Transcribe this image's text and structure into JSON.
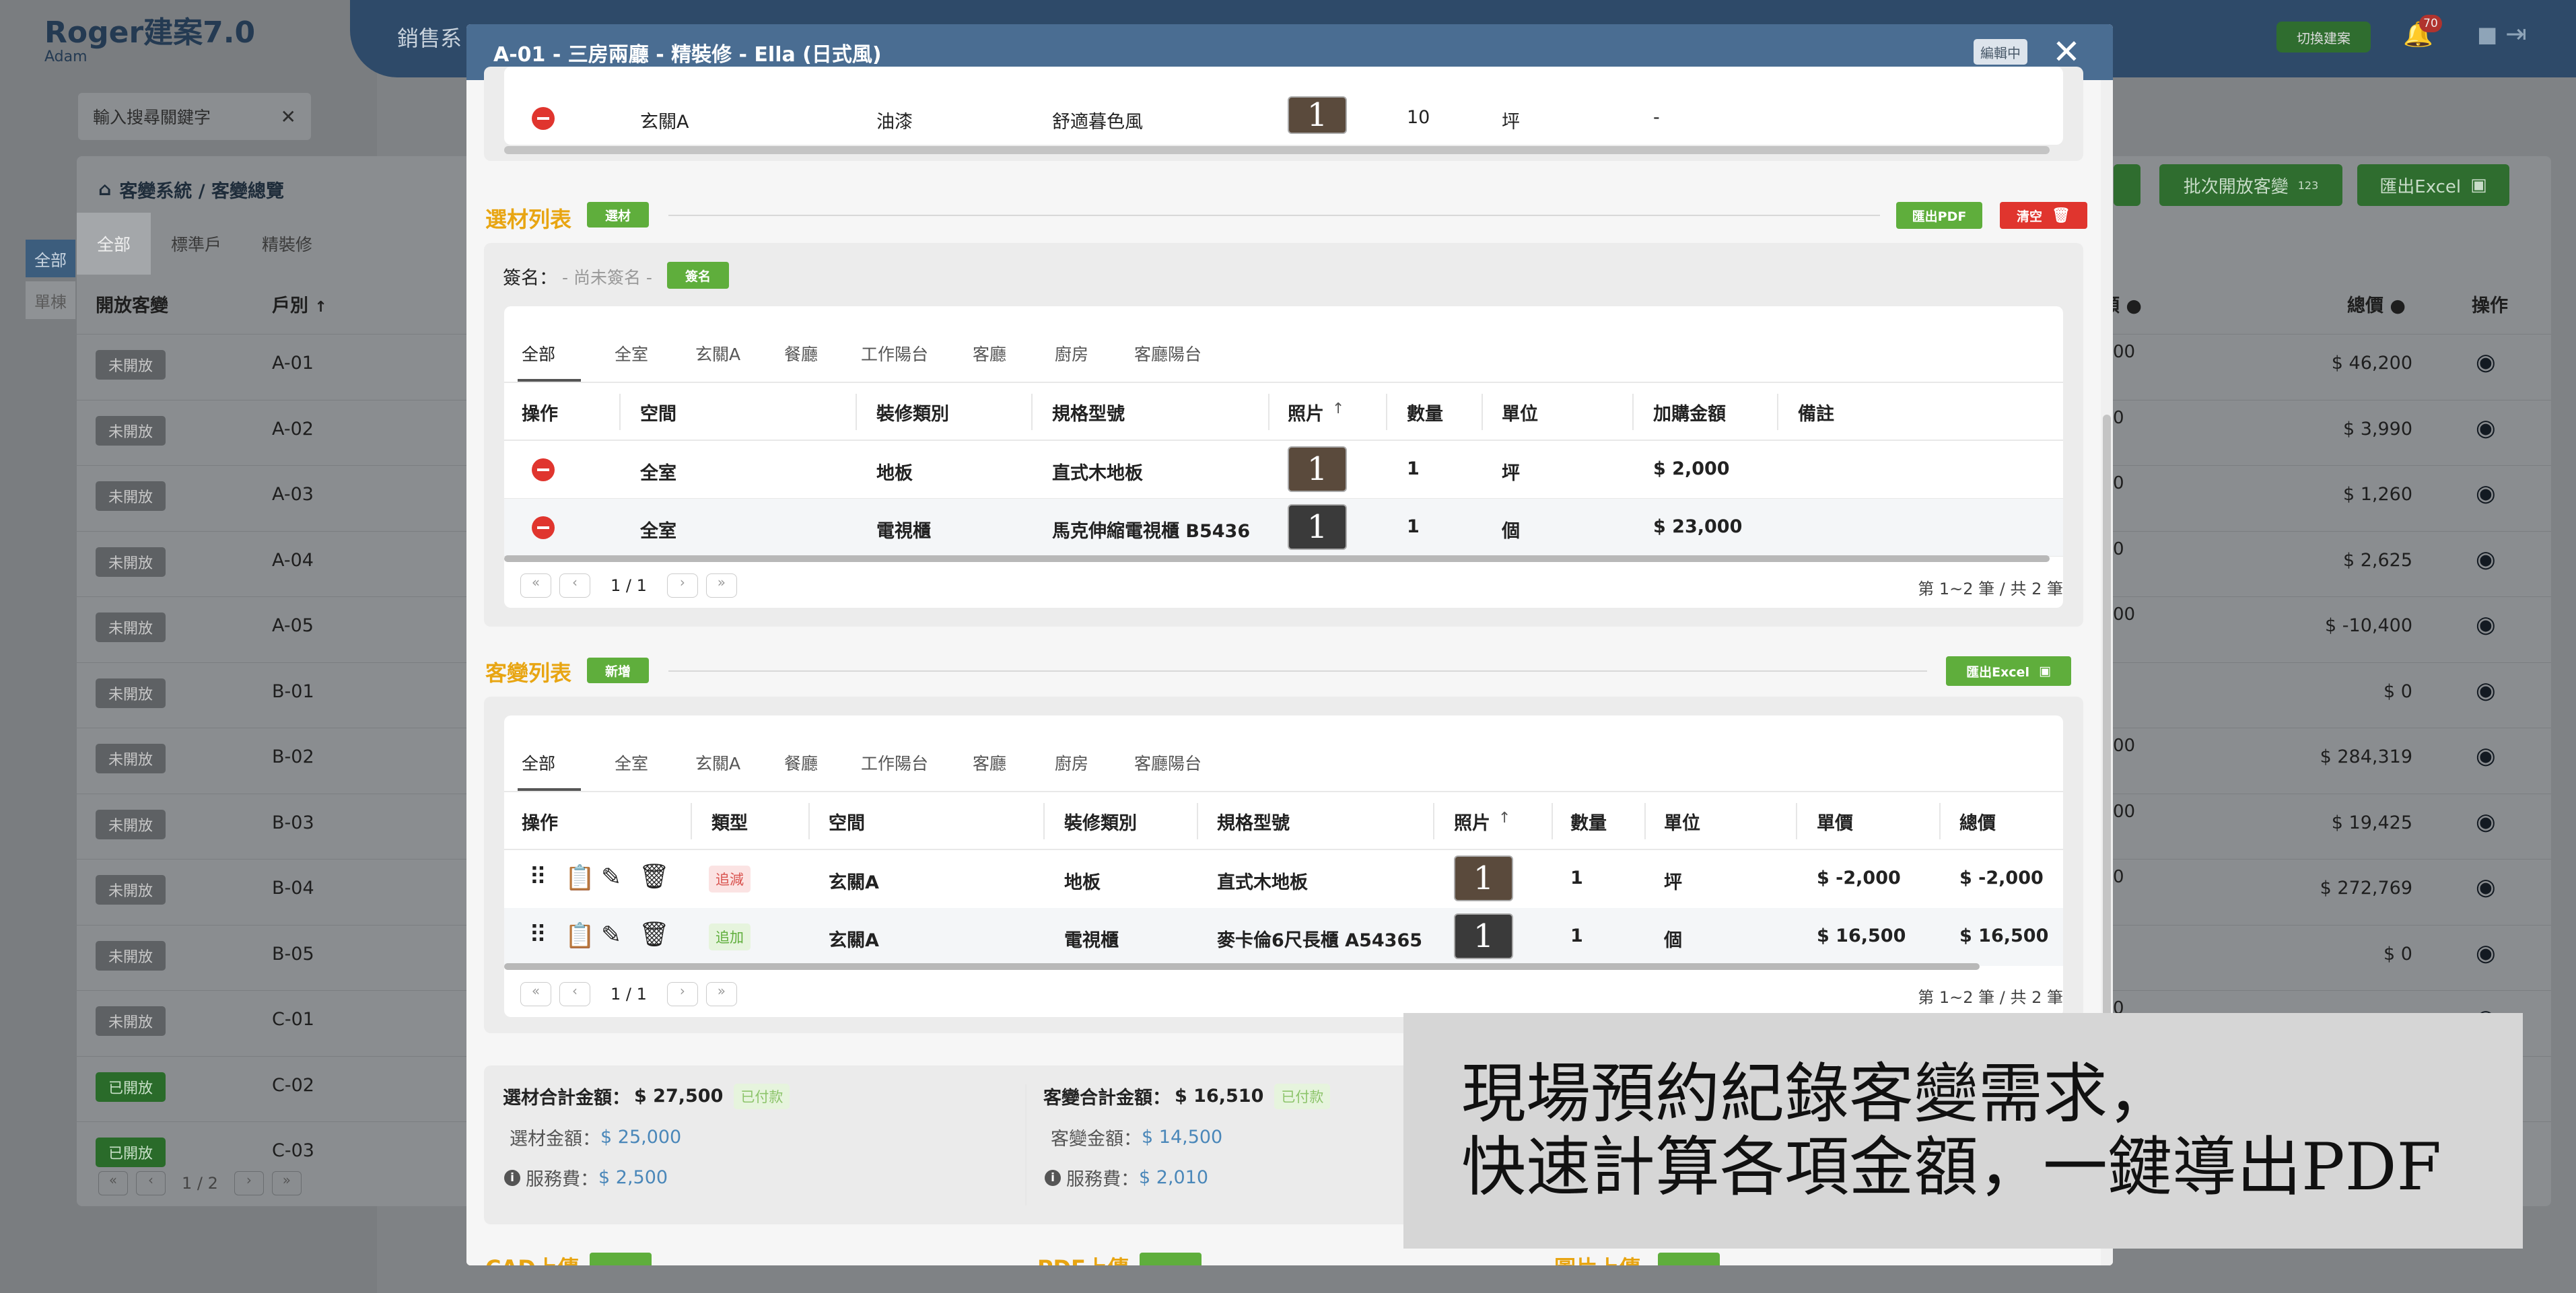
{
  "app": {
    "brand": "Roger建案7.0",
    "user": "Adam",
    "nav_label": "銷售系",
    "switch_label": "切換建案",
    "notification_count": "70",
    "search_placeholder": "輸入搜尋關鍵字",
    "breadcrumb": "客變系統 / 客變總覽",
    "tabs": [
      "全部",
      "標準戶",
      "精裝修"
    ],
    "side_tabs": [
      "全部",
      "單棟"
    ],
    "columns": {
      "open": "開放客變",
      "unit": "戶別"
    },
    "right_columns": {
      "amount_suffix": "額",
      "total": "總價",
      "ops": "操作"
    },
    "buttons": {
      "batch_open": "批次開放客變",
      "batch_badge": "123",
      "export_excel": "匯出Excel"
    },
    "rows": [
      {
        "status": "未開放",
        "unit": "A-01",
        "amount_frag": "00",
        "total": "$ 46,200",
        "open": false
      },
      {
        "status": "未開放",
        "unit": "A-02",
        "amount_frag": "0",
        "total": "$ 3,990",
        "open": false
      },
      {
        "status": "未開放",
        "unit": "A-03",
        "amount_frag": "0",
        "total": "$ 1,260",
        "open": false
      },
      {
        "status": "未開放",
        "unit": "A-04",
        "amount_frag": "0",
        "total": "$ 2,625",
        "open": false
      },
      {
        "status": "未開放",
        "unit": "A-05",
        "amount_frag": "00",
        "total": "$ -10,400",
        "open": false
      },
      {
        "status": "未開放",
        "unit": "B-01",
        "amount_frag": "",
        "total": "$ 0",
        "open": false
      },
      {
        "status": "未開放",
        "unit": "B-02",
        "amount_frag": "00",
        "total": "$ 284,319",
        "open": false
      },
      {
        "status": "未開放",
        "unit": "B-03",
        "amount_frag": "00",
        "total": "$ 19,425",
        "open": false
      },
      {
        "status": "未開放",
        "unit": "B-04",
        "amount_frag": "0",
        "total": "$ 272,769",
        "open": false
      },
      {
        "status": "未開放",
        "unit": "B-05",
        "amount_frag": "",
        "total": "$ 0",
        "open": false
      },
      {
        "status": "未開放",
        "unit": "C-01",
        "amount_frag": "0",
        "total": "",
        "open": false
      },
      {
        "status": "已開放",
        "unit": "C-02",
        "amount_frag": "",
        "total": "",
        "open": true
      },
      {
        "status": "已開放",
        "unit": "C-03",
        "amount_frag": "",
        "total": "",
        "open": true
      }
    ],
    "pager": {
      "page": "1 / 2"
    }
  },
  "modal": {
    "title": "A-01 - 三房兩廳 - 精裝修 - Ella (日式風)",
    "editing_badge": "編輯中",
    "top_row": {
      "space": "玄關A",
      "category": "油漆",
      "spec": "舒適暮色風",
      "qty": "10",
      "unit": "坪",
      "price": "-"
    },
    "selection": {
      "title": "選材列表",
      "tag": "選材",
      "export_pdf": "匯出PDF",
      "clear": "清空",
      "sign_label": "簽名：",
      "sign_placeholder": "- 尚未簽名 -",
      "sign_button": "簽名",
      "tabs": [
        "全部",
        "全室",
        "玄關A",
        "餐廳",
        "工作陽台",
        "客廳",
        "廚房",
        "客廳陽台"
      ],
      "columns": [
        "操作",
        "空間",
        "裝修類別",
        "規格型號",
        "照片",
        "數量",
        "單位",
        "加購金額",
        "備註"
      ],
      "rows": [
        {
          "space": "全室",
          "category": "地板",
          "spec": "直式木地板",
          "photo": "1",
          "qty": "1",
          "unit": "坪",
          "amount": "$ 2,000",
          "note": ""
        },
        {
          "space": "全室",
          "category": "電視櫃",
          "spec": "馬克伸縮電視櫃 B5436",
          "photo": "1",
          "qty": "1",
          "unit": "個",
          "amount": "$ 23,000",
          "note": ""
        }
      ],
      "pager": {
        "page": "1 / 1",
        "summary": "第 1~2 筆 / 共 2 筆"
      }
    },
    "changes": {
      "title": "客變列表",
      "tag": "新增",
      "export_excel": "匯出Excel",
      "tabs": [
        "全部",
        "全室",
        "玄關A",
        "餐廳",
        "工作陽台",
        "客廳",
        "廚房",
        "客廳陽台"
      ],
      "columns": [
        "操作",
        "類型",
        "空間",
        "裝修類別",
        "規格型號",
        "照片",
        "數量",
        "單位",
        "單價",
        "總價"
      ],
      "rows": [
        {
          "type": "追減",
          "type_kind": "minus",
          "space": "玄關A",
          "category": "地板",
          "spec": "直式木地板",
          "photo": "1",
          "qty": "1",
          "unit": "坪",
          "price": "$ -2,000",
          "total": "$ -2,000"
        },
        {
          "type": "追加",
          "type_kind": "plus",
          "space": "玄關A",
          "category": "電視櫃",
          "spec": "麥卡倫6尺長櫃 A54365",
          "photo": "1",
          "qty": "1",
          "unit": "個",
          "price": "$ 16,500",
          "total": "$ 16,500"
        }
      ],
      "pager": {
        "page": "1 / 1",
        "summary": "第 1~2 筆 / 共 2 筆"
      }
    },
    "summary": {
      "selection_total_label": "選材合計金額：",
      "selection_total": "$ 27,500",
      "selection_paid": "已付款",
      "selection_amount_label": "選材金額：",
      "selection_amount": "$ 25,000",
      "selection_fee_label": "服務費：",
      "selection_fee": "$ 2,500",
      "change_total_label": "客變合計金額：",
      "change_total": "$ 16,510",
      "change_paid": "已付款",
      "change_amount_label": "客變金額：",
      "change_amount": "$ 14,500",
      "change_fee_label": "服務費：",
      "change_fee": "$ 2,010"
    },
    "bottom_labels": [
      "CAD上傳",
      "PDF上傳",
      "圖片上傳"
    ]
  },
  "overlay": {
    "line1": "現場預約紀錄客變需求，",
    "line2": "快速計算各項金額，一鍵導出PDF"
  },
  "colors": {
    "header": "#4a6d92",
    "accent_title": "#e8a512",
    "green": "#5fae3c",
    "red": "#e0352e"
  }
}
